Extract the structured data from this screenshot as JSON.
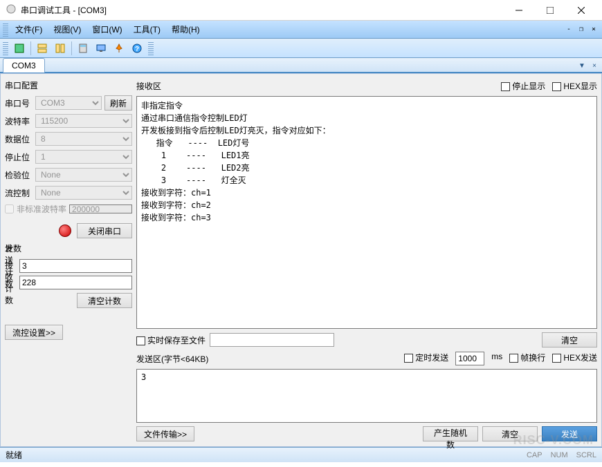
{
  "title": "串口调试工具 - [COM3]",
  "menubar": {
    "file": "文件(F)",
    "view": "视图(V)",
    "window": "窗口(W)",
    "tools": "工具(T)",
    "help": "帮助(H)"
  },
  "toolbar_icons": [
    "新建",
    "窗口1",
    "窗口2",
    "",
    "计算",
    "设置",
    "锁定",
    "帮助"
  ],
  "tab": {
    "com3": "COM3"
  },
  "left": {
    "config_title": "串口配置",
    "port_label": "串口号",
    "port_value": "COM3",
    "refresh": "刷新",
    "baud_label": "波特率",
    "baud_value": "115200",
    "databits_label": "数据位",
    "databits_value": "8",
    "stopbits_label": "停止位",
    "stopbits_value": "1",
    "parity_label": "检验位",
    "parity_value": "None",
    "flow_label": "流控制",
    "flow_value": "None",
    "nonstd_label": "非标准波特率",
    "nonstd_value": "200000",
    "close_port": "关闭串口",
    "counts_title": "计数",
    "send_count_label": "发送计数",
    "send_count_value": "3",
    "recv_count_label": "接收计数",
    "recv_count_value": "228",
    "clear_counts": "清空计数",
    "flow_settings": "流控设置>>"
  },
  "recv": {
    "title": "接收区",
    "stop_display": "停止显示",
    "hex_display": "HEX显示",
    "content": "非指定指令\n通过串口通信指令控制LED灯\n开发板接到指令后控制LED灯亮灭，指令对应如下：\n   指令   ----  LED灯号\n    1    ----   LED1亮\n    2    ----   LED2亮\n    3    ----   灯全灭\n接收到字符：ch=1\n接收到字符：ch=2\n接收到字符：ch=3"
  },
  "file_row": {
    "realtime_save": "实时保存至文件",
    "clear": "清空"
  },
  "send": {
    "title": "发送区(字节<64KB)",
    "timed_send": "定时发送",
    "interval": "1000",
    "ms": "ms",
    "frame_wrap": "帧换行",
    "hex_send": "HEX发送",
    "content": "3",
    "file_transfer": "文件传输>>",
    "gen_random": "产生随机数",
    "clear": "清空",
    "send_btn": "发送"
  },
  "status": {
    "ready": "就绪",
    "cap": "CAP",
    "num": "NUM",
    "scrl": "SCRL"
  },
  "watermark": "RISC-V.COM"
}
